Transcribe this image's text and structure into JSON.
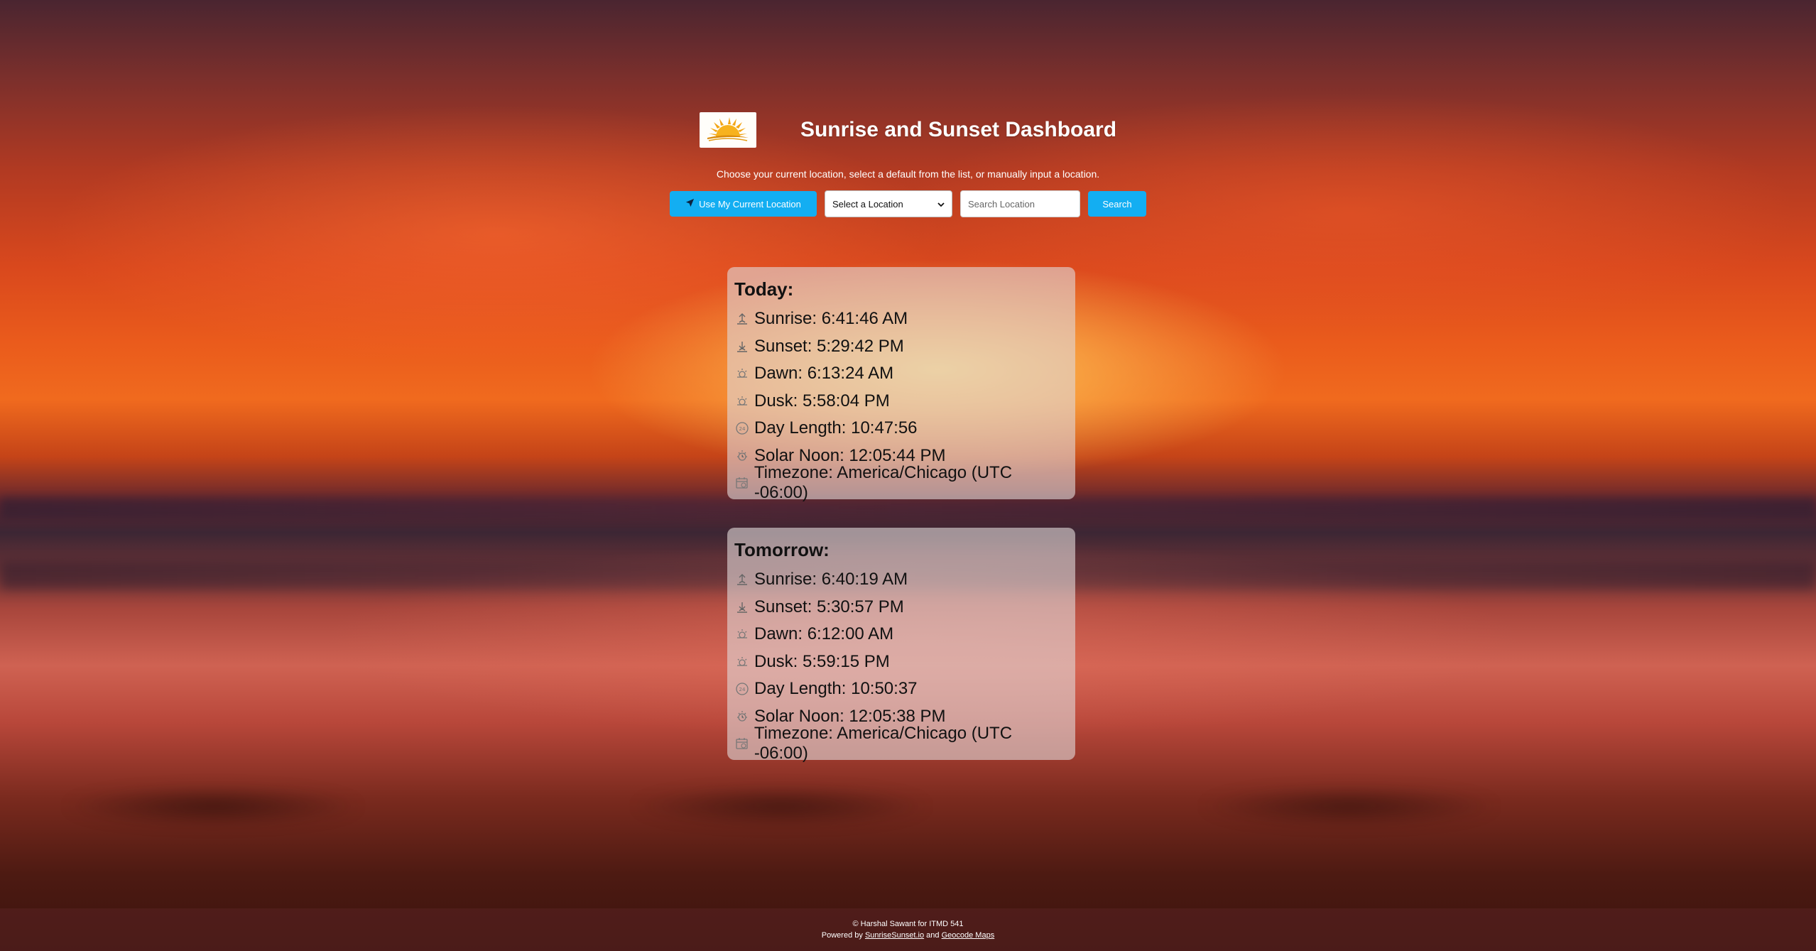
{
  "header": {
    "title": "Sunrise and Sunset Dashboard",
    "logo_icon": "sun-logo-icon"
  },
  "instructions": "Choose your current location, select a default from the list, or manually input a location.",
  "controls": {
    "locate_label": "Use My Current Location",
    "select_value": "Select a Location",
    "search_placeholder": "Search Location",
    "search_label": "Search"
  },
  "today": {
    "heading": "Today:",
    "sunrise": "Sunrise: 6:41:46 AM",
    "sunset": "Sunset: 5:29:42 PM",
    "dawn": "Dawn: 6:13:24 AM",
    "dusk": "Dusk: 5:58:04 PM",
    "day_length": "Day Length: 10:47:56",
    "solar_noon": "Solar Noon: 12:05:44 PM",
    "timezone": "Timezone: America/Chicago (UTC -06:00)"
  },
  "tomorrow": {
    "heading": "Tomorrow:",
    "sunrise": "Sunrise: 6:40:19 AM",
    "sunset": "Sunset: 5:30:57 PM",
    "dawn": "Dawn: 6:12:00 AM",
    "dusk": "Dusk: 5:59:15 PM",
    "day_length": "Day Length: 10:50:37",
    "solar_noon": "Solar Noon: 12:05:38 PM",
    "timezone": "Timezone: America/Chicago (UTC -06:00)"
  },
  "footer": {
    "copyright": "© Harshal Sawant for ITMD 541",
    "powered_prefix": "Powered by",
    "link1": "SunriseSunset.io",
    "and_text": "and",
    "link2": "Geocode Maps"
  },
  "colors": {
    "button": "#13aef2",
    "card_bg": "rgba(225,215,215,0.62)"
  }
}
